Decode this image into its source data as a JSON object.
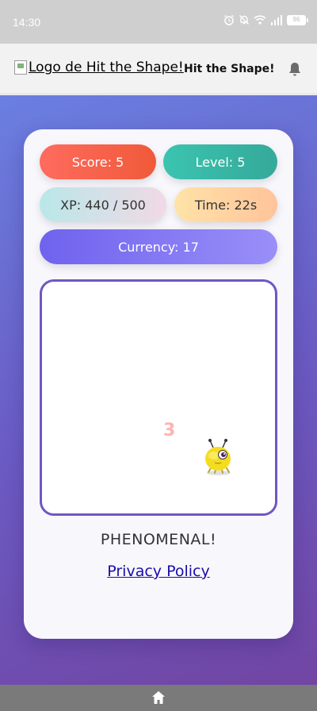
{
  "status_bar": {
    "time": "14:30",
    "battery": "96",
    "icons": [
      "alarm-icon",
      "mute-icon",
      "wifi-icon",
      "signal-icon",
      "battery-icon"
    ]
  },
  "header": {
    "logo_alt": "Logo de Hit the Shape!",
    "title": "Hit the Shape!",
    "icons": [
      "bell-icon"
    ]
  },
  "stats": {
    "score": "Score: 5",
    "level": "Level: 5",
    "xp": "XP: 440 / 500",
    "time": "Time: 22s",
    "currency": "Currency: 17"
  },
  "game": {
    "countdown": "3",
    "character": "yellow-bug"
  },
  "message": "PHENOMENAL!",
  "privacy_link": "Privacy Policy",
  "colors": {
    "score_pill": "#f05a3a",
    "level_pill": "#35a99a",
    "currency_pill": "#7a6ff0",
    "game_border": "#6f57c4",
    "background_gradient_start": "#6a7fe0",
    "background_gradient_end": "#7145a3"
  },
  "nav": {
    "icons": [
      "home-icon"
    ]
  }
}
